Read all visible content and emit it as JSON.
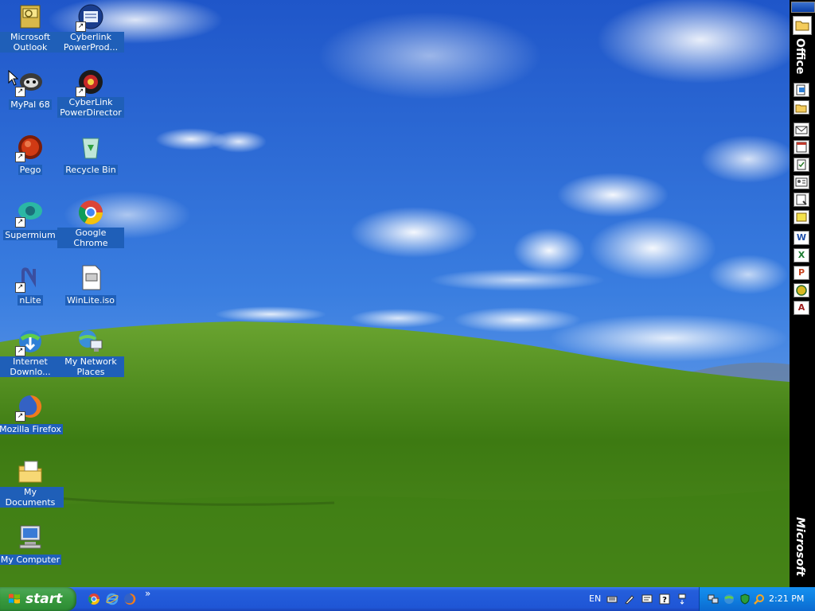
{
  "desktop": {
    "icons": [
      {
        "label": "Microsoft Outlook",
        "icon": "outlook-icon"
      },
      {
        "label": "Cyberlink PowerProd...",
        "icon": "cyberlink-powerproducer-icon"
      },
      {
        "label": "MyPal 68",
        "icon": "mypal-icon"
      },
      {
        "label": "CyberLink PowerDirector",
        "icon": "cyberlink-powerdirector-icon"
      },
      {
        "label": "Pego",
        "icon": "pego-icon"
      },
      {
        "label": "Recycle Bin",
        "icon": "recycle-bin-icon"
      },
      {
        "label": "Supermium",
        "icon": "supermium-icon"
      },
      {
        "label": "Google Chrome",
        "icon": "chrome-icon"
      },
      {
        "label": "nLite",
        "icon": "nlite-icon"
      },
      {
        "label": "WinLite.iso",
        "icon": "iso-file-icon"
      },
      {
        "label": "Internet Downlo...",
        "icon": "internet-download-manager-icon"
      },
      {
        "label": "My Network Places",
        "icon": "network-places-icon"
      },
      {
        "label": "Mozilla Firefox",
        "icon": "firefox-icon"
      },
      {
        "label": "My Documents",
        "icon": "my-documents-icon"
      },
      {
        "label": "My Computer",
        "icon": "my-computer-icon"
      }
    ]
  },
  "officebar": {
    "title": "Office",
    "brand": "Microsoft",
    "buttons": [
      "new-office-document-icon",
      "open-office-document-icon",
      "new-message-icon",
      "new-appointment-icon",
      "new-task-icon",
      "new-contact-icon",
      "new-journal-entry-icon",
      "new-note-icon",
      "word-icon",
      "excel-icon",
      "powerpoint-icon",
      "publisher-icon",
      "access-icon"
    ],
    "word": "W",
    "excel": "X",
    "powerpoint": "P",
    "access": "A"
  },
  "taskbar": {
    "start_label": "start",
    "quick_launch": [
      "chrome-icon",
      "internet-explorer-icon",
      "firefox-icon"
    ],
    "chevron": "»",
    "language": "EN",
    "clock": "2:21 PM"
  },
  "colors": {
    "sky": "#2f6fd6",
    "grass": "#4d8a1d",
    "taskbar": "#245edb",
    "start": "#389a3e",
    "tray": "#0f7fe0"
  }
}
